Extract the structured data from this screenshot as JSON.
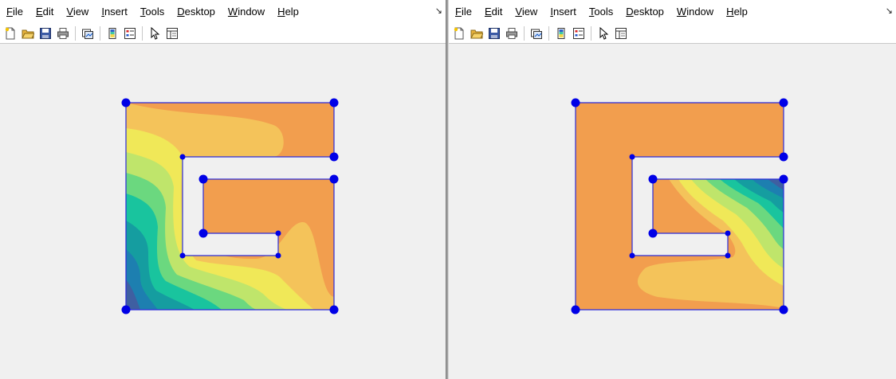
{
  "menus": [
    "File",
    "Edit",
    "View",
    "Insert",
    "Tools",
    "Desktop",
    "Window",
    "Help"
  ],
  "toolbar_icons": [
    "new-file-icon",
    "open-file-icon",
    "save-icon",
    "print-icon",
    "link-plot-icon",
    "insert-colorbar-icon",
    "insert-legend-icon",
    "pointer-icon",
    "property-inspector-icon"
  ],
  "colors": {
    "c1": "#3f5fa1",
    "c2": "#1d7fb0",
    "c3": "#159da0",
    "c4": "#19c49e",
    "c5": "#6bd87f",
    "c6": "#bfe56b",
    "c7": "#f0e858",
    "c8": "#f4c35a",
    "c9": "#f29e4e",
    "boundary": "#2b2bd9",
    "vertex": "#0000e6"
  }
}
